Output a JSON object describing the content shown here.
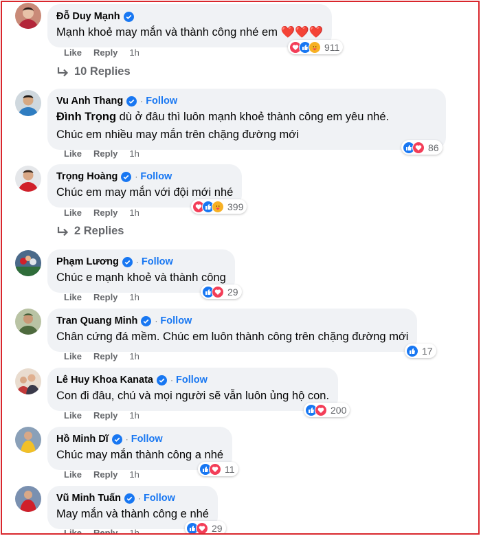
{
  "accent": "#1877f2",
  "border_color": "#d9262c",
  "labels": {
    "like": "Like",
    "reply": "Reply",
    "follow": "Follow"
  },
  "comments": [
    {
      "name": "Đỗ Duy Mạnh",
      "verified": true,
      "follow": false,
      "text": "Mạnh khoẻ may mắn và thành công nhé em ❤️❤️❤️",
      "time": "1h",
      "reactions": [
        "love",
        "like",
        "care"
      ],
      "count": "911",
      "replies": "10 Replies"
    },
    {
      "name": "Vu Anh Thang",
      "verified": true,
      "follow": true,
      "tag": "Đình Trọng",
      "text": " dù ở đâu thì luôn mạnh khoẻ thành công em yêu nhé.",
      "text2": "Chúc em nhiều may mắn trên chặng đường mới",
      "time": "1h",
      "reactions": [
        "like",
        "love"
      ],
      "count": "86"
    },
    {
      "name": "Trọng Hoàng",
      "verified": true,
      "follow": true,
      "text": "Chúc em may mắn với đội mới nhé",
      "time": "1h",
      "reactions": [
        "love",
        "like",
        "care"
      ],
      "count": "399",
      "replies": "2 Replies"
    },
    {
      "name": "Phạm Lương",
      "verified": true,
      "follow": true,
      "text": "Chúc e mạnh khoẻ và thành công",
      "time": "1h",
      "reactions": [
        "like",
        "love"
      ],
      "count": "29"
    },
    {
      "name": "Tran Quang Minh",
      "verified": true,
      "follow": true,
      "text": "Chân cứng đá mềm. Chúc em luôn thành công trên chặng đường mới",
      "time": "1h",
      "reactions": [
        "like"
      ],
      "count": "17"
    },
    {
      "name": "Lê Huy Khoa Kanata",
      "verified": true,
      "follow": true,
      "text": "Con đi đâu, chú và mọi người sẽ vẫn luôn ủng hộ con.",
      "time": "1h",
      "reactions": [
        "like",
        "love"
      ],
      "count": "200"
    },
    {
      "name": "Hồ Minh Dĩ",
      "verified": true,
      "follow": true,
      "text": "Chúc may mắn thành công a nhé",
      "time": "1h",
      "reactions": [
        "like",
        "love"
      ],
      "count": "11"
    },
    {
      "name": "Vũ Minh Tuấn",
      "verified": true,
      "follow": true,
      "text": "May mắn và thành công e nhé",
      "time": "1h",
      "reactions": [
        "like",
        "love"
      ],
      "count": "29"
    }
  ]
}
